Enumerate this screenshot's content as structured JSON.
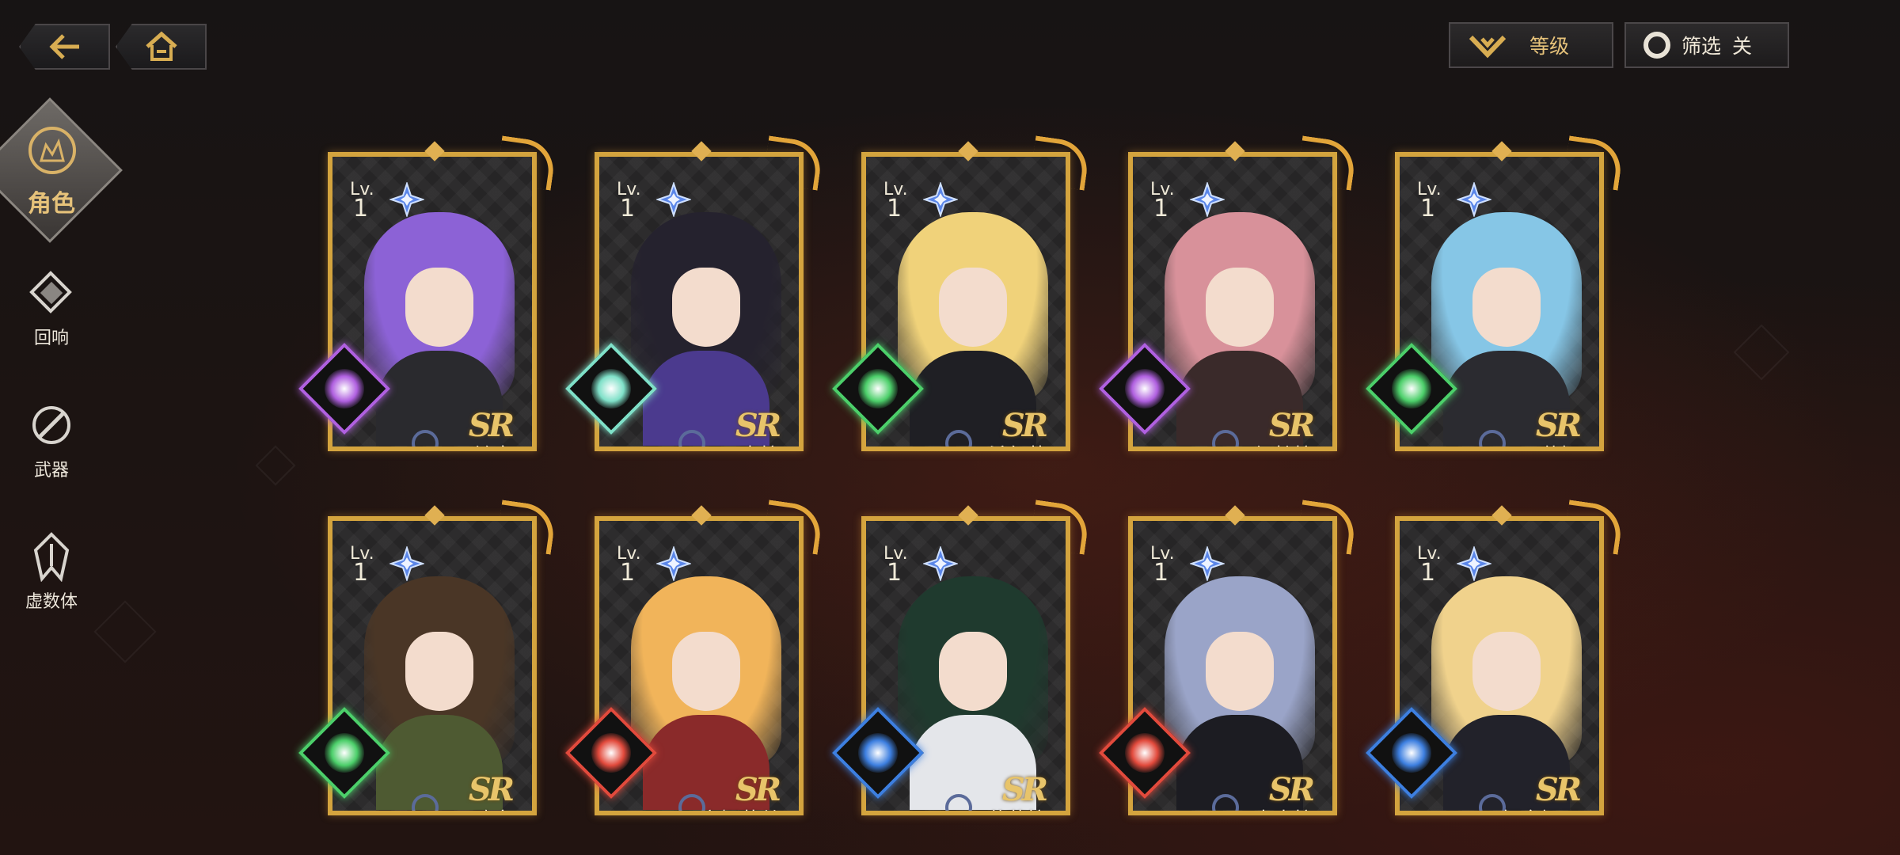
{
  "nav": {
    "back_icon": "back-arrow-icon",
    "home_icon": "home-icon"
  },
  "top": {
    "sort_label": "等级",
    "filter_label": "筛选",
    "filter_state": "关"
  },
  "sidebar": {
    "items": [
      {
        "label": "角色",
        "icon": "character-icon",
        "active": true
      },
      {
        "label": "回响",
        "icon": "echo-icon",
        "active": false
      },
      {
        "label": "武器",
        "icon": "weapon-icon",
        "active": false
      },
      {
        "label": "虚数体",
        "icon": "imaginary-icon",
        "active": false
      }
    ]
  },
  "cards": [
    {
      "name": "铃音",
      "lv_label": "Lv.",
      "level": "1",
      "rarity": "SR",
      "element": "arcane",
      "element_color": "#b060e0",
      "hair": "#8c62d6",
      "outfit": "#2a2a2e"
    },
    {
      "name": "米拉",
      "lv_label": "Lv.",
      "level": "1",
      "rarity": "SR",
      "element": "sun",
      "element_color": "#7fe0c8",
      "hair": "#25222e",
      "outfit": "#4b3a8e"
    },
    {
      "name": "希尔芙",
      "lv_label": "Lv.",
      "level": "1",
      "rarity": "SR",
      "element": "wind",
      "element_color": "#4ccf6a",
      "hair": "#f0d27a",
      "outfit": "#1f1f24"
    },
    {
      "name": "佩特拉",
      "lv_label": "Lv.",
      "level": "1",
      "rarity": "SR",
      "element": "arcane",
      "element_color": "#b060e0",
      "hair": "#d8919a",
      "outfit": "#3a2a2a"
    },
    {
      "name": "蕾妮",
      "lv_label": "Lv.",
      "level": "1",
      "rarity": "SR",
      "element": "wind",
      "element_color": "#4ccf6a",
      "hair": "#86c6e6",
      "outfit": "#2b2b30"
    },
    {
      "name": "欧文",
      "lv_label": "Lv.",
      "level": "1",
      "rarity": "SR",
      "element": "wind",
      "element_color": "#4ccf6a",
      "hair": "#4a3626",
      "outfit": "#4e5a32"
    },
    {
      "name": "安娜莉丝",
      "lv_label": "Lv.",
      "level": "1",
      "rarity": "SR",
      "element": "fire",
      "element_color": "#e24a3c",
      "hair": "#f1b45a",
      "outfit": "#8a2a2a"
    },
    {
      "name": "艾薇拉",
      "lv_label": "Lv.",
      "level": "1",
      "rarity": "SR",
      "element": "water",
      "element_color": "#3d7fe0",
      "hair": "#1f3a2e",
      "outfit": "#e4e6ea"
    },
    {
      "name": "卡米拉",
      "lv_label": "Lv.",
      "level": "1",
      "rarity": "SR",
      "element": "fire",
      "element_color": "#e24a3c",
      "hair": "#9aa4c8",
      "outfit": "#1c1c22"
    },
    {
      "name": "柯塞妮亚",
      "lv_label": "Lv.",
      "level": "1",
      "rarity": "SR",
      "element": "water",
      "element_color": "#3d7fe0",
      "hair": "#f0d28c",
      "outfit": "#22222a"
    }
  ]
}
